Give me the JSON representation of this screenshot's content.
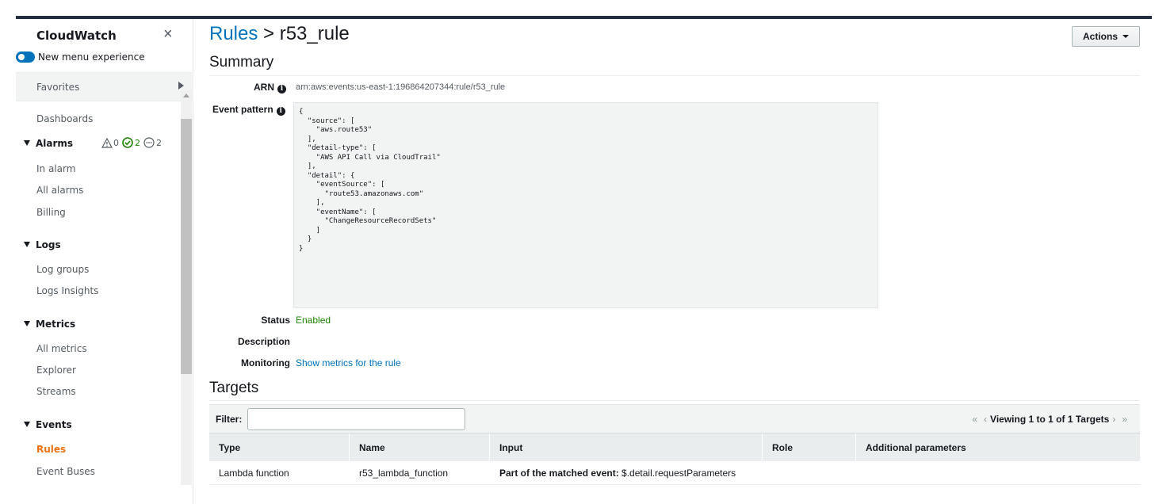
{
  "sidebar": {
    "title": "CloudWatch",
    "close_glyph": "×",
    "toggle_label": "New menu experience",
    "favorites_label": "Favorites",
    "items": {
      "dashboards": "Dashboards",
      "alarms": "Alarms",
      "in_alarm": "In alarm",
      "all_alarms": "All alarms",
      "billing": "Billing",
      "logs": "Logs",
      "log_groups": "Log groups",
      "logs_insights": "Logs Insights",
      "metrics": "Metrics",
      "all_metrics": "All metrics",
      "explorer": "Explorer",
      "streams": "Streams",
      "events": "Events",
      "rules": "Rules",
      "event_buses": "Event Buses"
    },
    "alarm_counts": {
      "in_alarm": "0",
      "ok": "2",
      "insufficient": "2"
    }
  },
  "header": {
    "crumb_link": "Rules",
    "separator": " > ",
    "current": "r53_rule",
    "actions_label": "Actions"
  },
  "summary": {
    "heading": "Summary",
    "arn_label": "ARN",
    "arn_value": "arn:aws:events:us-east-1:196864207344:rule/r53_rule",
    "event_pattern_label": "Event pattern",
    "event_pattern": "{\n  \"source\": [\n    \"aws.route53\"\n  ],\n  \"detail-type\": [\n    \"AWS API Call via CloudTrail\"\n  ],\n  \"detail\": {\n    \"eventSource\": [\n      \"route53.amazonaws.com\"\n    ],\n    \"eventName\": [\n      \"ChangeResourceRecordSets\"\n    ]\n  }\n}",
    "status_label": "Status",
    "status_value": "Enabled",
    "description_label": "Description",
    "monitoring_label": "Monitoring",
    "monitoring_link": "Show metrics for the rule"
  },
  "targets": {
    "heading": "Targets",
    "filter_label": "Filter:",
    "filter_value": "",
    "pager_first": "«",
    "pager_prev": "‹",
    "pager_text": "Viewing 1 to 1 of 1 Targets",
    "pager_next": "›",
    "pager_last": "»",
    "columns": [
      "Type",
      "Name",
      "Input",
      "Role",
      "Additional parameters"
    ],
    "rows": [
      {
        "type": "Lambda function",
        "name": "r53_lambda_function",
        "input_bold": "Part of the matched event:",
        "input_value": " $.detail.requestParameters",
        "role": "",
        "additional": ""
      }
    ]
  },
  "colors": {
    "link": "#0073bb",
    "active_nav": "#ec7211",
    "status_enabled": "#1d8102",
    "ok_green": "#1d8102"
  }
}
